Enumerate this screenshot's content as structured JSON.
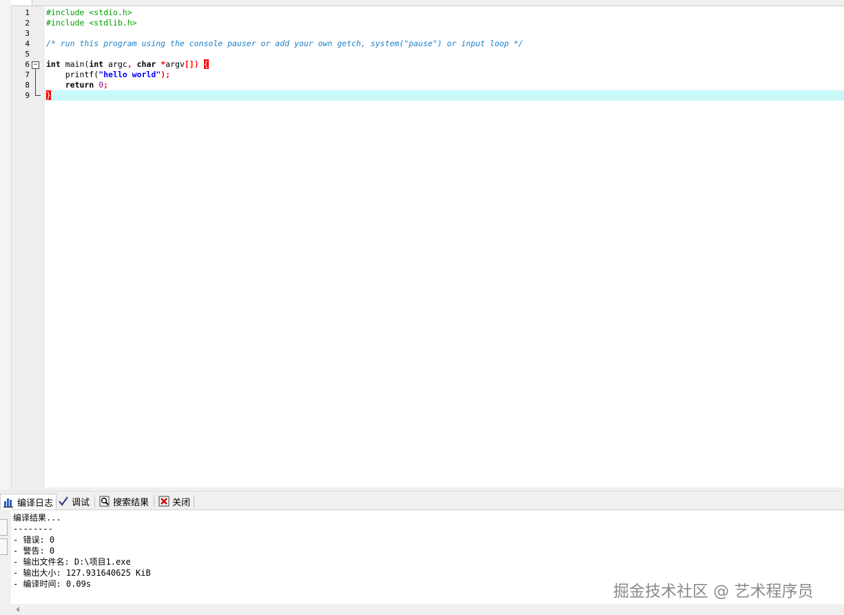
{
  "editor": {
    "line_numbers": [
      "1",
      "2",
      "3",
      "4",
      "5",
      "6",
      "7",
      "8",
      "9"
    ],
    "lines": {
      "l1": "#include <stdio.h>",
      "l2": "#include <stdlib.h>",
      "l4": "/* run this program using the console pauser or add your own getch, system(\"pause\") or input loop */",
      "l6_kw1": "int",
      "l6_a": " main(",
      "l6_kw2": "int",
      "l6_b": " argc",
      "l6_c": ", ",
      "l6_kw3": "char",
      "l6_d": " ",
      "l6_e": "*",
      "l6_f": "argv",
      "l6_g": "[])",
      "l6_h": " ",
      "l6_brace": "{",
      "l7_a": "    printf(",
      "l7_str": "\"hello world\"",
      "l7_b": ");",
      "l8_kw": "    return",
      "l8_a": " ",
      "l8_num": "0",
      "l8_b": ";",
      "l9_brace": "}"
    },
    "current_line": 9,
    "colors": {
      "preprocessor": "#00a000",
      "comment": "#2080c8",
      "string": "#0000ff",
      "operator": "#ff0000",
      "current_line_bg": "#c8f8f8"
    }
  },
  "bottom_panel": {
    "tabs": [
      {
        "label": "编译日志",
        "icon": "bar-chart-icon"
      },
      {
        "label": "调试",
        "icon": "checkmark-icon"
      },
      {
        "label": "搜索结果",
        "icon": "search-icon"
      },
      {
        "label": "关闭",
        "icon": "close-icon"
      }
    ],
    "output": [
      "编译结果...",
      "--------",
      "- 错误: 0",
      "- 警告: 0",
      "- 输出文件名: D:\\项目1.exe",
      "- 输出大小: 127.931640625 KiB",
      "- 编译时间: 0.09s"
    ]
  },
  "watermark": "掘金技术社区 @ 艺术程序员"
}
